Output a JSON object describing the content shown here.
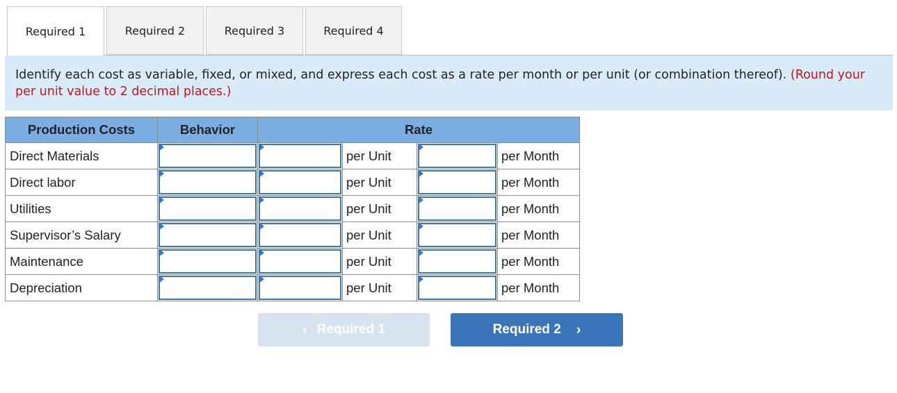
{
  "tabs": [
    {
      "label": "Required 1",
      "active": true
    },
    {
      "label": "Required 2",
      "active": false
    },
    {
      "label": "Required 3",
      "active": false
    },
    {
      "label": "Required 4",
      "active": false
    }
  ],
  "instructions": {
    "text": "Identify each cost as variable, fixed, or mixed, and express each cost as a rate per month or per unit (or combination thereof).",
    "note": "(Round your per unit value to 2 decimal places.)"
  },
  "table": {
    "headers": {
      "costs": "Production Costs",
      "behavior": "Behavior",
      "rate": "Rate"
    },
    "per_unit_label": "per Unit",
    "per_month_label": "per Month",
    "rows": [
      {
        "label": "Direct Materials",
        "unit": "per Unit",
        "month": "per Month"
      },
      {
        "label": "Direct labor",
        "unit": "per Unit",
        "month": "per Month"
      },
      {
        "label": "Utilities",
        "unit": "per Unit",
        "month": "per Month"
      },
      {
        "label": "Supervisor’s Salary",
        "unit": "per Unit",
        "month": "per Month"
      },
      {
        "label": "Maintenance",
        "unit": "per Unit",
        "month": "per Month"
      },
      {
        "label": "Depreciation",
        "unit": "per Unit",
        "month": "per Month"
      }
    ]
  },
  "nav": {
    "prev_label": "Required 1",
    "prev_icon": "‹",
    "next_label": "Required 2",
    "next_icon": "›"
  }
}
